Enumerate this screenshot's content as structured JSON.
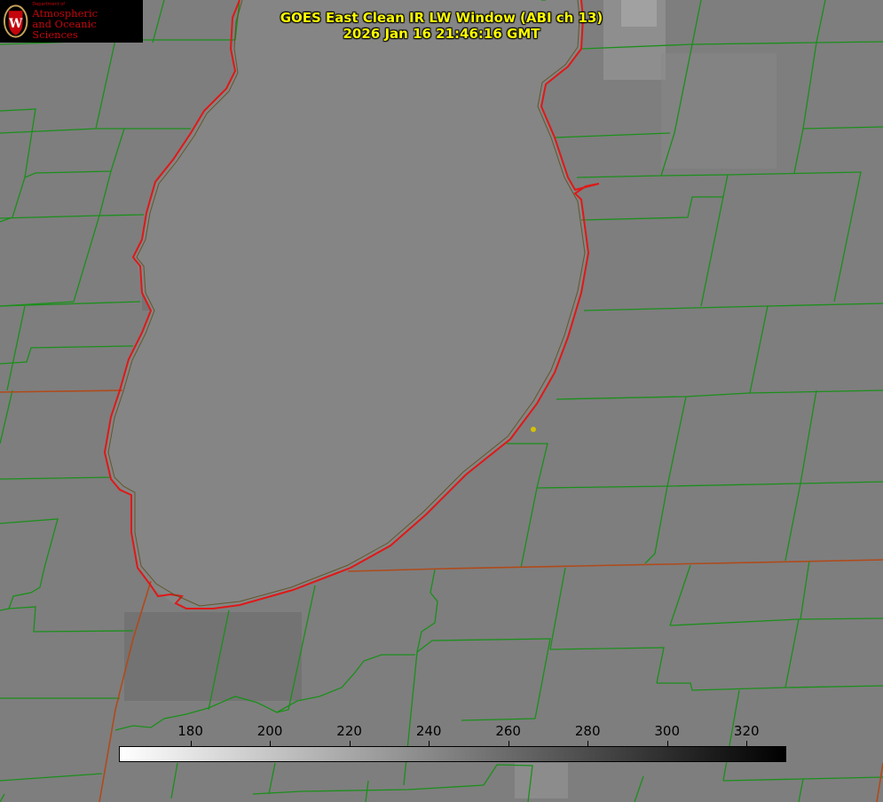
{
  "logo": {
    "department": "Department of",
    "line1": "Atmospheric",
    "line2": "and Oceanic Sciences"
  },
  "title": {
    "line1": "GOES East Clean IR LW Window (ABI ch 13)",
    "line2": "2026 Jan 16 21:46:16 GMT"
  },
  "colorbar": {
    "min": 162,
    "max": 330,
    "ticks": [
      180,
      200,
      220,
      240,
      260,
      280,
      300,
      320
    ],
    "colormap": "white-to-black"
  },
  "colors": {
    "background": "#7e7e7e",
    "lake": "#858585",
    "county_lines": "#1a8f1a",
    "state_lines": "#b04a1a",
    "shoreline": "#e01818",
    "title": "#ffff00",
    "marker": "#d4c200"
  }
}
